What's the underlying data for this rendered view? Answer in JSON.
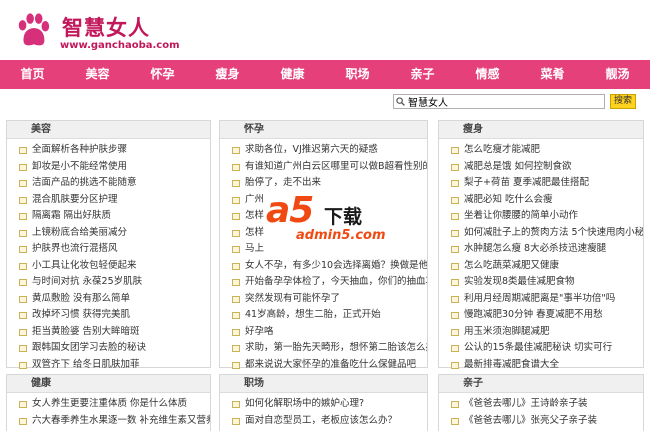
{
  "header": {
    "site_title": "智慧女人",
    "site_url": "www.ganchaoba.com"
  },
  "colors": {
    "brand": "#e5407a",
    "logo": "#c2185b",
    "search_button": "#ffd21f"
  },
  "nav": {
    "items": [
      "首页",
      "美容",
      "怀孕",
      "瘦身",
      "健康",
      "职场",
      "亲子",
      "情感",
      "菜肴",
      "靓汤"
    ]
  },
  "search": {
    "value": "智慧女人",
    "button_label": "搜索"
  },
  "panels": [
    {
      "title": "美容",
      "items": [
        "全面解析各种护肤步骤",
        "卸妆是小不能经常使用",
        "洁面产品的挑选不能随意",
        "混合肌肤要分区护理",
        "隔离霜 隔出好肤质",
        "上镜粉底合给美丽减分",
        "护肤界也流行混搭风",
        "小工具让化妆包轻便起来",
        "与时间对抗 永葆25岁肌肤",
        "黄瓜敷脸 没有那么简单",
        "改掉坏习惯 获得完美肌",
        "拒当黄脸婆 告别大眸暗斑",
        "跟韩国女团学习去脸的秘诀",
        "双管齐下 给冬日肌肤加菲"
      ]
    },
    {
      "title": "怀孕",
      "items": [
        "求助各位，VJ推迟第六天的疑惑",
        "有谁知道广州白云区哪里可以做B超看性别的？",
        "胎停了，走不出来",
        "广州",
        "怎样",
        "怎样",
        "马上",
        "女人不孕，有多少10会选择离婚？换做是他，你会不",
        "开始备孕孕体检了，今天抽血，你们的抽血项目是这",
        "突然发现有可能怀孕了",
        "41岁高龄，想生二胎，正式开始",
        "好孕咯",
        "求助，第一胎先天畸形，想怀第二胎该怎么办？",
        "都来说说大家怀孕的准备吃什么保健品吧"
      ]
    },
    {
      "title": "瘦身",
      "items": [
        "怎么吃瘦才能减肥",
        "减肥总是饿 如何控制食欲",
        "梨子+荷苗 夏季减肥最佳搭配",
        "减肥必知 吃什么会瘦",
        "坐着让你腰腰的简单小动作",
        "如何减肚子上的赘肉方法 5个快速甩肉小秘方",
        "水肿腿怎么瘦 8大必杀技迅速瘦腿",
        "怎么吃蔬菜减肥又健康",
        "实验发现8类最佳减肥食物",
        "利用月经周期减肥离是\"事半功倍\"吗",
        "慢跑减肥30分钟 春夏减肥不用愁",
        "用玉米须泡脚腿减肥",
        "公认的15条最佳减肥秘诀 切实可行",
        "最新排毒减肥食谱大全"
      ]
    },
    {
      "title": "健康",
      "items": [
        "女人养生更要注重体质 你是什么体质",
        "六大春季养生水果逐一数 补充维生素又营养"
      ]
    },
    {
      "title": "职场",
      "items": [
        "如何化解职场中的嫉妒心理?",
        "面对自恋型员工，老板应该怎么办？"
      ]
    },
    {
      "title": "亲子",
      "items": [
        "《爸爸去哪儿》王诗龄亲子装",
        "《爸爸去哪儿》张亮父子亲子装"
      ]
    }
  ],
  "watermark": {
    "logo_text": "a5",
    "chinese": "下载",
    "url": "admin5.com"
  }
}
